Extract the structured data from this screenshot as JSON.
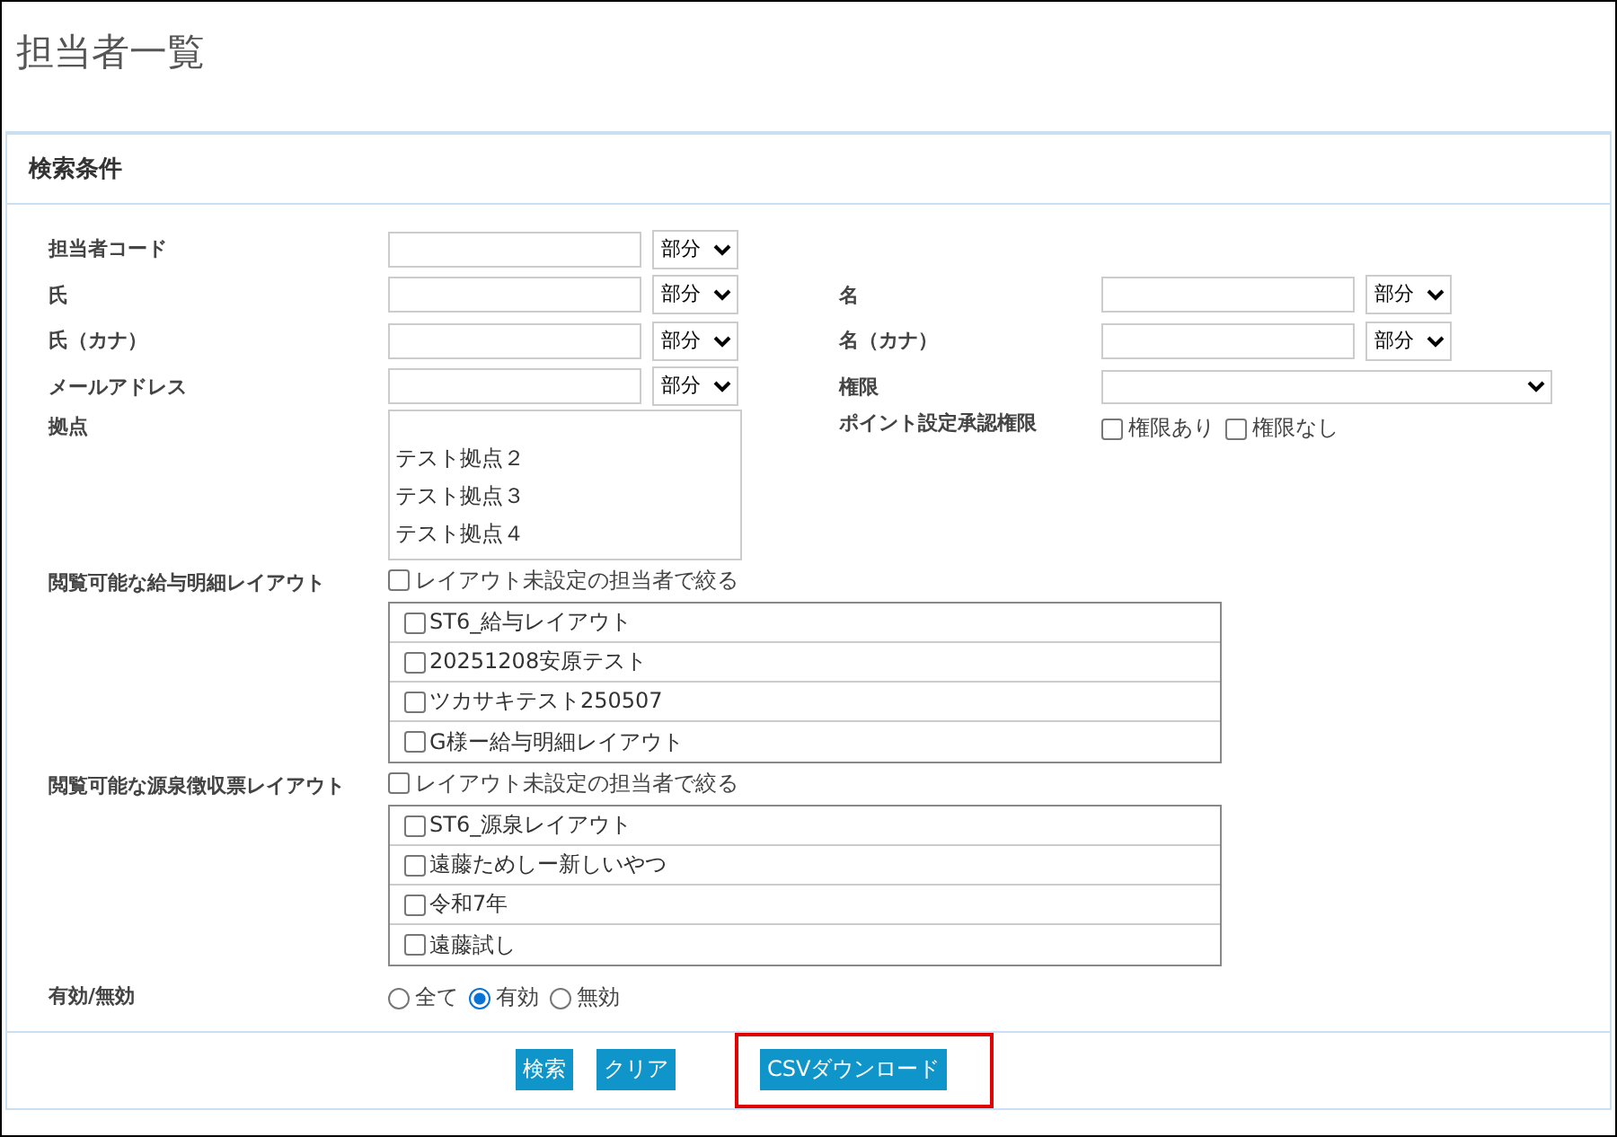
{
  "page": {
    "title": "担当者一覧"
  },
  "panel": {
    "title": "検索条件"
  },
  "fields": {
    "code": {
      "label": "担当者コード",
      "match": "部分"
    },
    "last": {
      "label": "氏",
      "match": "部分"
    },
    "first": {
      "label": "名",
      "match": "部分"
    },
    "last_kana": {
      "label": "氏（カナ）",
      "match": "部分"
    },
    "first_kana": {
      "label": "名（カナ）",
      "match": "部分"
    },
    "email": {
      "label": "メールアドレス",
      "match": "部分"
    },
    "role": {
      "label": "権限"
    }
  },
  "base": {
    "label": "拠点",
    "options": [
      {
        "label": "テスト拠点２",
        "selected": false
      },
      {
        "label": "テスト拠点３",
        "selected": false
      },
      {
        "label": "テスト拠点４",
        "selected": false
      }
    ]
  },
  "point_approval": {
    "label": "ポイント設定承認権限",
    "options": [
      {
        "label": "権限あり",
        "checked": false
      },
      {
        "label": "権限なし",
        "checked": false
      }
    ]
  },
  "layout_groups": [
    {
      "label": "閲覧可能な給与明細レイアウト",
      "filter": {
        "label": "レイアウト未設定の担当者で絞る",
        "checked": false
      },
      "items": [
        {
          "label": "ST6_給与レイアウト",
          "checked": false
        },
        {
          "label": "20251208安原テスト",
          "checked": false
        },
        {
          "label": "ツカサキテスト250507",
          "checked": false
        },
        {
          "label": "G様ー給与明細レイアウト",
          "checked": false
        }
      ]
    },
    {
      "label": "閲覧可能な源泉徴収票レイアウト",
      "filter": {
        "label": "レイアウト未設定の担当者で絞る",
        "checked": false
      },
      "items": [
        {
          "label": "ST6_源泉レイアウト",
          "checked": false
        },
        {
          "label": "遠藤ためしー新しいやつ",
          "checked": false
        },
        {
          "label": "令和7年",
          "checked": false
        },
        {
          "label": "遠藤試し",
          "checked": false
        }
      ]
    }
  ],
  "status": {
    "label": "有効/無効",
    "options": [
      {
        "label": "全て",
        "selected": false
      },
      {
        "label": "有効",
        "selected": true
      },
      {
        "label": "無効",
        "selected": false
      }
    ]
  },
  "buttons": [
    {
      "label": "検索",
      "highlighted": false
    },
    {
      "label": "クリア",
      "highlighted": false
    },
    {
      "label": "CSVダウンロード",
      "highlighted": true
    }
  ]
}
